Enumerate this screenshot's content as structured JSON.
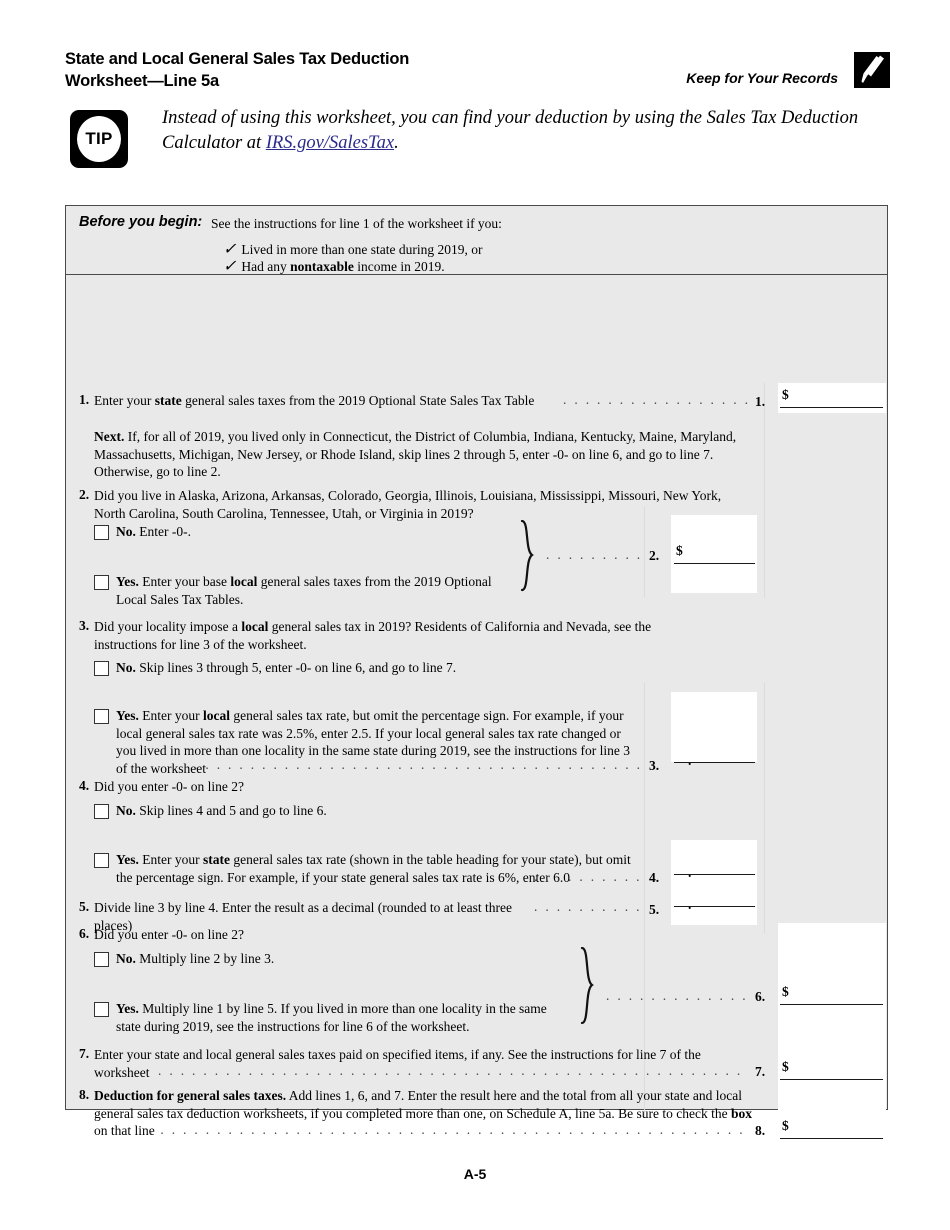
{
  "header": {
    "title_line1": "State and Local General Sales Tax Deduction",
    "title_line2": "Worksheet—Line 5a",
    "keep_for_records": "Keep for Your Records",
    "records_icon": "pen-icon"
  },
  "tip": {
    "badge": "TIP",
    "text_before_link": "Instead of using this worksheet, you can find your deduction by using the Sales Tax Deduction Calculator at ",
    "link_text": "IRS.gov/SalesTax",
    "text_after_link": "."
  },
  "before_you_begin": {
    "label": "Before you begin:",
    "lead": "See the instructions for line 1 of the worksheet if you:",
    "check_glyph": "✓",
    "items": [
      {
        "text": "Lived in more than one state during 2019, or"
      },
      {
        "pre": "Had any ",
        "bold": "nontaxable",
        "post": " income in 2019."
      }
    ]
  },
  "lines": {
    "l1": {
      "num": "1.",
      "text_a": "Enter your ",
      "bold_a": "state",
      "text_b": " general sales taxes from the 2019 Optional State Sales Tax Table",
      "rnum": "1.",
      "dollar": "$"
    },
    "next_note": {
      "bold": "Next.",
      "text": " If, for all of 2019, you lived only in Connecticut, the District of Columbia, Indiana, Kentucky, Maine, Maryland, Massachusetts, Michigan, New Jersey, or Rhode Island, skip lines 2 through 5, enter -0- on line 6, and go to line 7. Otherwise, go to line 2."
    },
    "l2": {
      "num": "2.",
      "text": "Did you live in Alaska, Arizona, Arkansas, Colorado, Georgia, Illinois, Louisiana, Mississippi, Missouri, New York, North Carolina, South Carolina, Tennessee, Utah, or Virginia in 2019?",
      "no": {
        "bold": "No.",
        "text": " Enter -0-."
      },
      "yes": {
        "bold": "Yes.",
        "text_a": " Enter your base ",
        "bold_a": "local",
        "text_b": " general sales taxes from the 2019 Optional Local Sales Tax Tables."
      },
      "rnum": "2.",
      "dollar": "$"
    },
    "l3": {
      "num": "3.",
      "text_a": "Did your locality impose a ",
      "bold_a": "local",
      "text_b": " general sales tax in 2019? Residents of California and Nevada, see the instructions for line 3 of the worksheet.",
      "no": {
        "bold": "No.",
        "text": " Skip lines 3 through 5, enter -0- on line 6, and go to line 7."
      },
      "yes": {
        "bold": "Yes.",
        "text_a": " Enter your ",
        "bold_a": "local",
        "text_b": " general sales tax rate, but omit the percentage sign. For example, if your local general sales tax rate was 2.5%, enter 2.5. If your local general sales tax rate changed or you lived in more than one locality in the same state during 2019, see the instructions for line 3 of the worksheet"
      },
      "rnum": "3.",
      "decimal": "."
    },
    "l4": {
      "num": "4.",
      "text": "Did you enter -0- on line 2?",
      "no": {
        "bold": "No.",
        "text": " Skip lines 4 and 5 and go to line 6."
      },
      "yes": {
        "bold": "Yes.",
        "text_a": " Enter your ",
        "bold_a": "state",
        "text_b": " general sales tax rate (shown in the table heading for your state), but omit the percentage sign. For example, if your state general sales tax rate is 6%, enter 6.0"
      },
      "rnum": "4.",
      "decimal": "."
    },
    "l5": {
      "num": "5.",
      "text": "Divide line 3 by line 4. Enter the result as a decimal (rounded to at least three places)",
      "rnum": "5.",
      "decimal": "."
    },
    "l6": {
      "num": "6.",
      "text": "Did you enter -0- on line 2?",
      "no": {
        "bold": "No.",
        "text": " Multiply line 2 by line 3."
      },
      "yes": {
        "bold": "Yes.",
        "text": " Multiply line 1 by line 5. If you lived in more than one locality in the same state during 2019, see the instructions for line 6 of the worksheet."
      },
      "rnum": "6.",
      "dollar": "$"
    },
    "l7": {
      "num": "7.",
      "text": "Enter your state and local general sales taxes paid on specified items, if any. See the instructions for line 7 of the worksheet",
      "rnum": "7.",
      "dollar": "$"
    },
    "l8": {
      "num": "8.",
      "bold_a": "Deduction for general sales taxes.",
      "text_a": " Add lines 1, 6, and 7. Enter the result here and the total from all your state and local general sales tax deduction worksheets, if you completed more than one, on Schedule A, line 5a. Be sure to check the ",
      "bold_b": "box",
      "text_b": " on that line",
      "rnum": "8.",
      "dollar": "$"
    }
  },
  "footer": {
    "page": "A-5"
  }
}
